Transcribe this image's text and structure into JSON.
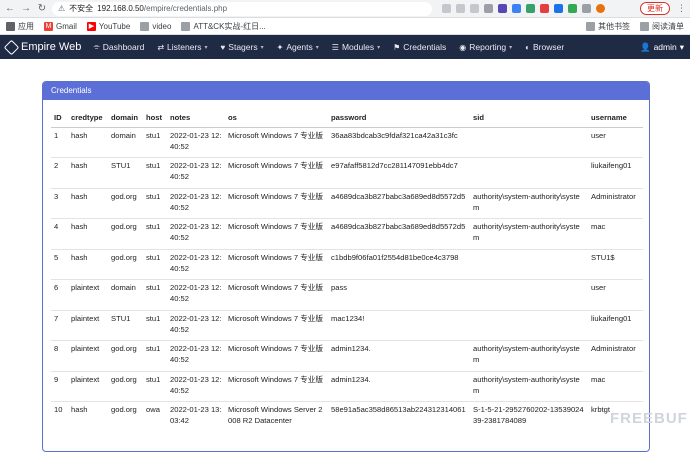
{
  "browser": {
    "security_label": "不安全",
    "url_host": "192.168.0.50",
    "url_path": "/empire/credentials.php",
    "update_label": "更新",
    "bookmarks": [
      {
        "label": "应用"
      },
      {
        "label": "Gmail"
      },
      {
        "label": "YouTube"
      },
      {
        "label": "video"
      },
      {
        "label": "ATT&CK实战-红日..."
      }
    ],
    "bookmarks_right": [
      {
        "label": "其他书签"
      },
      {
        "label": "阅读清单"
      }
    ]
  },
  "navbar": {
    "brand": "Empire Web",
    "items": [
      {
        "label": "Dashboard",
        "icon": "⌯"
      },
      {
        "label": "Listeners",
        "icon": "⇄",
        "caret": "▾"
      },
      {
        "label": "Stagers",
        "icon": "♥",
        "caret": "▾"
      },
      {
        "label": "Agents",
        "icon": "✦",
        "caret": "▾"
      },
      {
        "label": "Modules",
        "icon": "☰",
        "caret": "▾"
      },
      {
        "label": "Credentials",
        "icon": "⚑"
      },
      {
        "label": "Reporting",
        "icon": "◉",
        "caret": "▾"
      },
      {
        "label": "Browser",
        "icon": "◐"
      }
    ],
    "user": "admin",
    "user_caret": "▾"
  },
  "panel": {
    "title": "Credentials"
  },
  "table": {
    "columns": [
      "ID",
      "credtype",
      "domain",
      "host",
      "notes",
      "os",
      "password",
      "sid",
      "username"
    ],
    "rows": [
      [
        "1",
        "hash",
        "domain",
        "stu1",
        "2022-01-23 12:40:52",
        "Microsoft Windows 7 专业版",
        "36aa83bdcab3c9fdaf321ca42a31c3fc",
        "",
        "user"
      ],
      [
        "2",
        "hash",
        "STU1",
        "stu1",
        "2022-01-23 12:40:52",
        "Microsoft Windows 7 专业版",
        "e97afaff5812d7cc281147091ebb4dc7",
        "",
        "liukaifeng01"
      ],
      [
        "3",
        "hash",
        "god.org",
        "stu1",
        "2022-01-23 12:40:52",
        "Microsoft Windows 7 专业版",
        "a4689dca3b827babc3a689ed8d5572d5",
        "authority\\system-authority\\system",
        "Administrator"
      ],
      [
        "4",
        "hash",
        "god.org",
        "stu1",
        "2022-01-23 12:40:52",
        "Microsoft Windows 7 专业版",
        "a4689dca3b827babc3a689ed8d5572d5",
        "authority\\system-authority\\system",
        "mac"
      ],
      [
        "5",
        "hash",
        "god.org",
        "stu1",
        "2022-01-23 12:40:52",
        "Microsoft Windows 7 专业版",
        "c1bdb9f06fa01f2554d81be0ce4c3798",
        "",
        "STU1$"
      ],
      [
        "6",
        "plaintext",
        "domain",
        "stu1",
        "2022-01-23 12:40:52",
        "Microsoft Windows 7 专业版",
        "pass",
        "",
        "user"
      ],
      [
        "7",
        "plaintext",
        "STU1",
        "stu1",
        "2022-01-23 12:40:52",
        "Microsoft Windows 7 专业版",
        "mac1234!",
        "",
        "liukaifeng01"
      ],
      [
        "8",
        "plaintext",
        "god.org",
        "stu1",
        "2022-01-23 12:40:52",
        "Microsoft Windows 7 专业版",
        "admin1234.",
        "authority\\system-authority\\system",
        "Administrator"
      ],
      [
        "9",
        "plaintext",
        "god.org",
        "stu1",
        "2022-01-23 12:40:52",
        "Microsoft Windows 7 专业版",
        "admin1234.",
        "authority\\system-authority\\system",
        "mac"
      ],
      [
        "10",
        "hash",
        "god.org",
        "owa",
        "2022-01-23 13:03:42",
        "Microsoft Windows Server 2008 R2 Datacenter",
        "58e91a5ac358d86513ab224312314061",
        "S-1-5-21-2952760202-1353902439-2381784089",
        "krbtgt"
      ]
    ]
  },
  "watermark": "FREEBUF",
  "colors": {
    "navbar_bg": "#1f2a44",
    "panel_heading": "#5b6fd6",
    "update": "#d93025"
  }
}
